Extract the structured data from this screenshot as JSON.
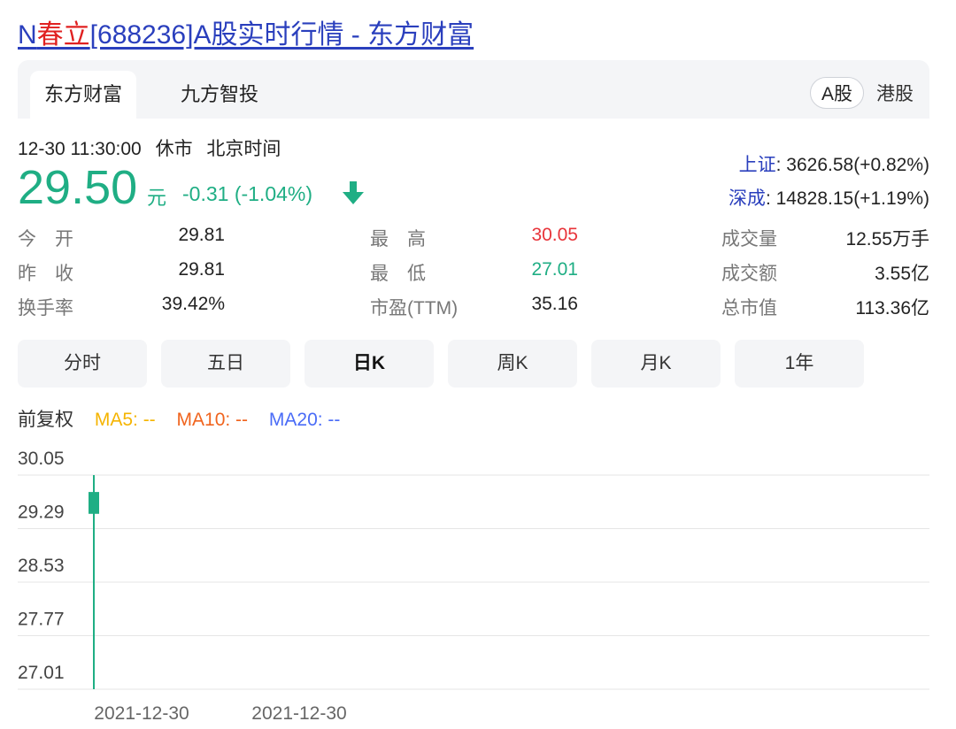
{
  "title": {
    "prefix": "N",
    "highlight": "春立",
    "rest": "[688236]A股实时行情 - 东方财富"
  },
  "source_tabs": [
    "东方财富",
    "九方智投"
  ],
  "market_toggle": {
    "a_share": "A股",
    "hk_share": "港股"
  },
  "status": {
    "datetime": "12-30 11:30:00",
    "state": "休市",
    "timezone": "北京时间"
  },
  "quote": {
    "price": "29.50",
    "unit": "元",
    "change": "-0.31 (-1.04%)"
  },
  "indices": [
    {
      "name": "上证",
      "value": ": 3626.58(+0.82%)"
    },
    {
      "name": "深成",
      "value": ": 14828.15(+1.19%)"
    }
  ],
  "stats": {
    "open_label": "今　开",
    "open_value": "29.81",
    "prev_close_label": "昨　收",
    "prev_close_value": "29.81",
    "turnover_label": "换手率",
    "turnover_value": "39.42%",
    "high_label": "最　高",
    "high_value": "30.05",
    "low_label": "最　低",
    "low_value": "27.01",
    "pe_label": "市盈(TTM)",
    "pe_value": "35.16",
    "volume_label": "成交量",
    "volume_value": "12.55万手",
    "amount_label": "成交额",
    "amount_value": "3.55亿",
    "market_cap_label": "总市值",
    "market_cap_value": "113.36亿"
  },
  "period_tabs": [
    "分时",
    "五日",
    "日K",
    "周K",
    "月K",
    "1年"
  ],
  "ma": {
    "adjust": "前复权",
    "ma5": "MA5: --",
    "ma10": "MA10: --",
    "ma20": "MA20: --"
  },
  "colors": {
    "up": "#e8343a",
    "down": "#1fae84",
    "ma5": "#f5b400",
    "ma10": "#f0641e",
    "ma20": "#4a6cf7",
    "link": "#2a3fbd"
  },
  "chart_data": {
    "type": "candlestick",
    "y_ticks": [
      "30.05",
      "29.29",
      "28.53",
      "27.77",
      "27.01"
    ],
    "ylim": [
      27.01,
      30.05
    ],
    "x_labels": [
      "2021-12-30",
      "2021-12-30"
    ],
    "candles": [
      {
        "date": "2021-12-30",
        "open": 29.81,
        "close": 29.5,
        "high": 30.05,
        "low": 27.01
      }
    ]
  }
}
